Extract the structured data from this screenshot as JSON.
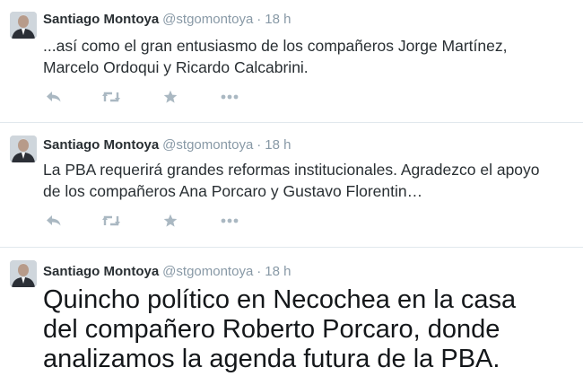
{
  "tweets": [
    {
      "author_name": "Santiago Montoya",
      "handle": "@stgomontoya",
      "separator": "·",
      "time": "18 h",
      "text_lines": [
        "...así como el gran entusiasmo  de los compañeros Jorge Martínez,",
        "Marcelo Ordoqui y Ricardo Calcabrini."
      ]
    },
    {
      "author_name": "Santiago Montoya",
      "handle": "@stgomontoya",
      "separator": "·",
      "time": "18 h",
      "text_lines": [
        "La PBA requerirá grandes reformas institucionales. Agradezco el apoyo",
        "de los compañeros Ana Porcaro y Gustavo Florentin…"
      ]
    },
    {
      "author_name": "Santiago Montoya",
      "handle": "@stgomontoya",
      "separator": "·",
      "time": "18 h",
      "text_lines": [
        "Quincho político en Necochea en la casa",
        "del compañero Roberto Porcaro, donde",
        "analizamos la agenda futura de la PBA."
      ]
    }
  ],
  "icons": {
    "reply": "reply-icon",
    "retweet": "retweet-icon",
    "favorite": "favorite-star-icon",
    "more": "more-dots-icon"
  },
  "colors": {
    "name": "#292f33",
    "meta": "#8899a6",
    "action_icon": "#aab8c2",
    "divider": "#e1e8ed"
  }
}
